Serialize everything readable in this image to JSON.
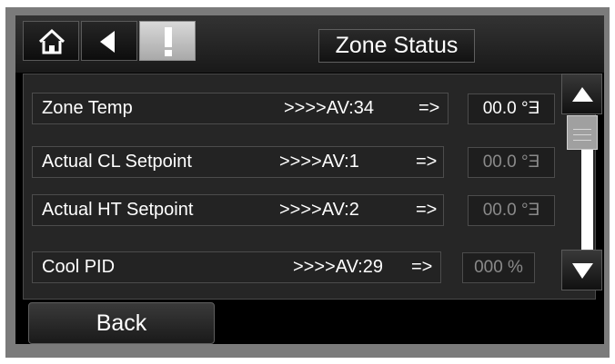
{
  "header": {
    "title": "Zone Status",
    "buttons": [
      {
        "name": "home",
        "icon": "home-icon"
      },
      {
        "name": "back",
        "icon": "back-arrow-icon"
      },
      {
        "name": "alarm",
        "icon": "exclamation-icon"
      }
    ]
  },
  "rows": [
    {
      "label": "Zone Temp",
      "ref": ">>>>AV:34",
      "arrow": "=>",
      "value": "00.0 °Ǝ",
      "value_color": "#ffffff"
    },
    {
      "label": "Actual CL Setpoint",
      "ref": ">>>>AV:1",
      "arrow": "=>",
      "value": "00.0 °Ǝ",
      "value_color": "#8a8a8a"
    },
    {
      "label": "Actual HT Setpoint",
      "ref": ">>>>AV:2",
      "arrow": "=>",
      "value": "00.0 °Ǝ",
      "value_color": "#8a8a8a"
    },
    {
      "label": "Cool PID",
      "ref": ">>>>AV:29",
      "arrow": "=>",
      "value": "000 %",
      "value_color": "#8a8a8a"
    }
  ],
  "scroll": {
    "up_icon": "up-arrow-icon",
    "down_icon": "down-arrow-icon"
  },
  "footer": {
    "back_label": "Back"
  },
  "colors": {
    "background": "#000000",
    "panel": "#262626",
    "bezel": "#7b7b7b",
    "alarm_button": "#c8c8c8"
  }
}
